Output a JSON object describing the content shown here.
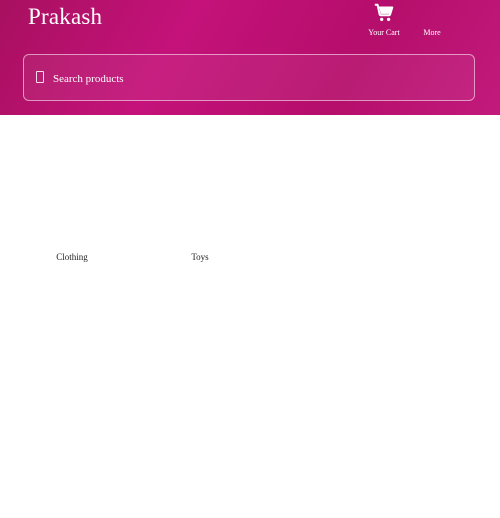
{
  "header": {
    "brand": "Prakash",
    "nav": [
      {
        "label": "Your Cart",
        "icon": "cart-icon"
      },
      {
        "label": "More"
      }
    ]
  },
  "search": {
    "placeholder": "Search products",
    "icon": "search-icon"
  },
  "categories": [
    {
      "label": "Clothing"
    },
    {
      "label": "Toys"
    }
  ],
  "colors": {
    "header_gradient_start": "#a8105f",
    "header_gradient_mid": "#c4127a",
    "header_text": "#ffffff",
    "body_text": "#222222"
  }
}
